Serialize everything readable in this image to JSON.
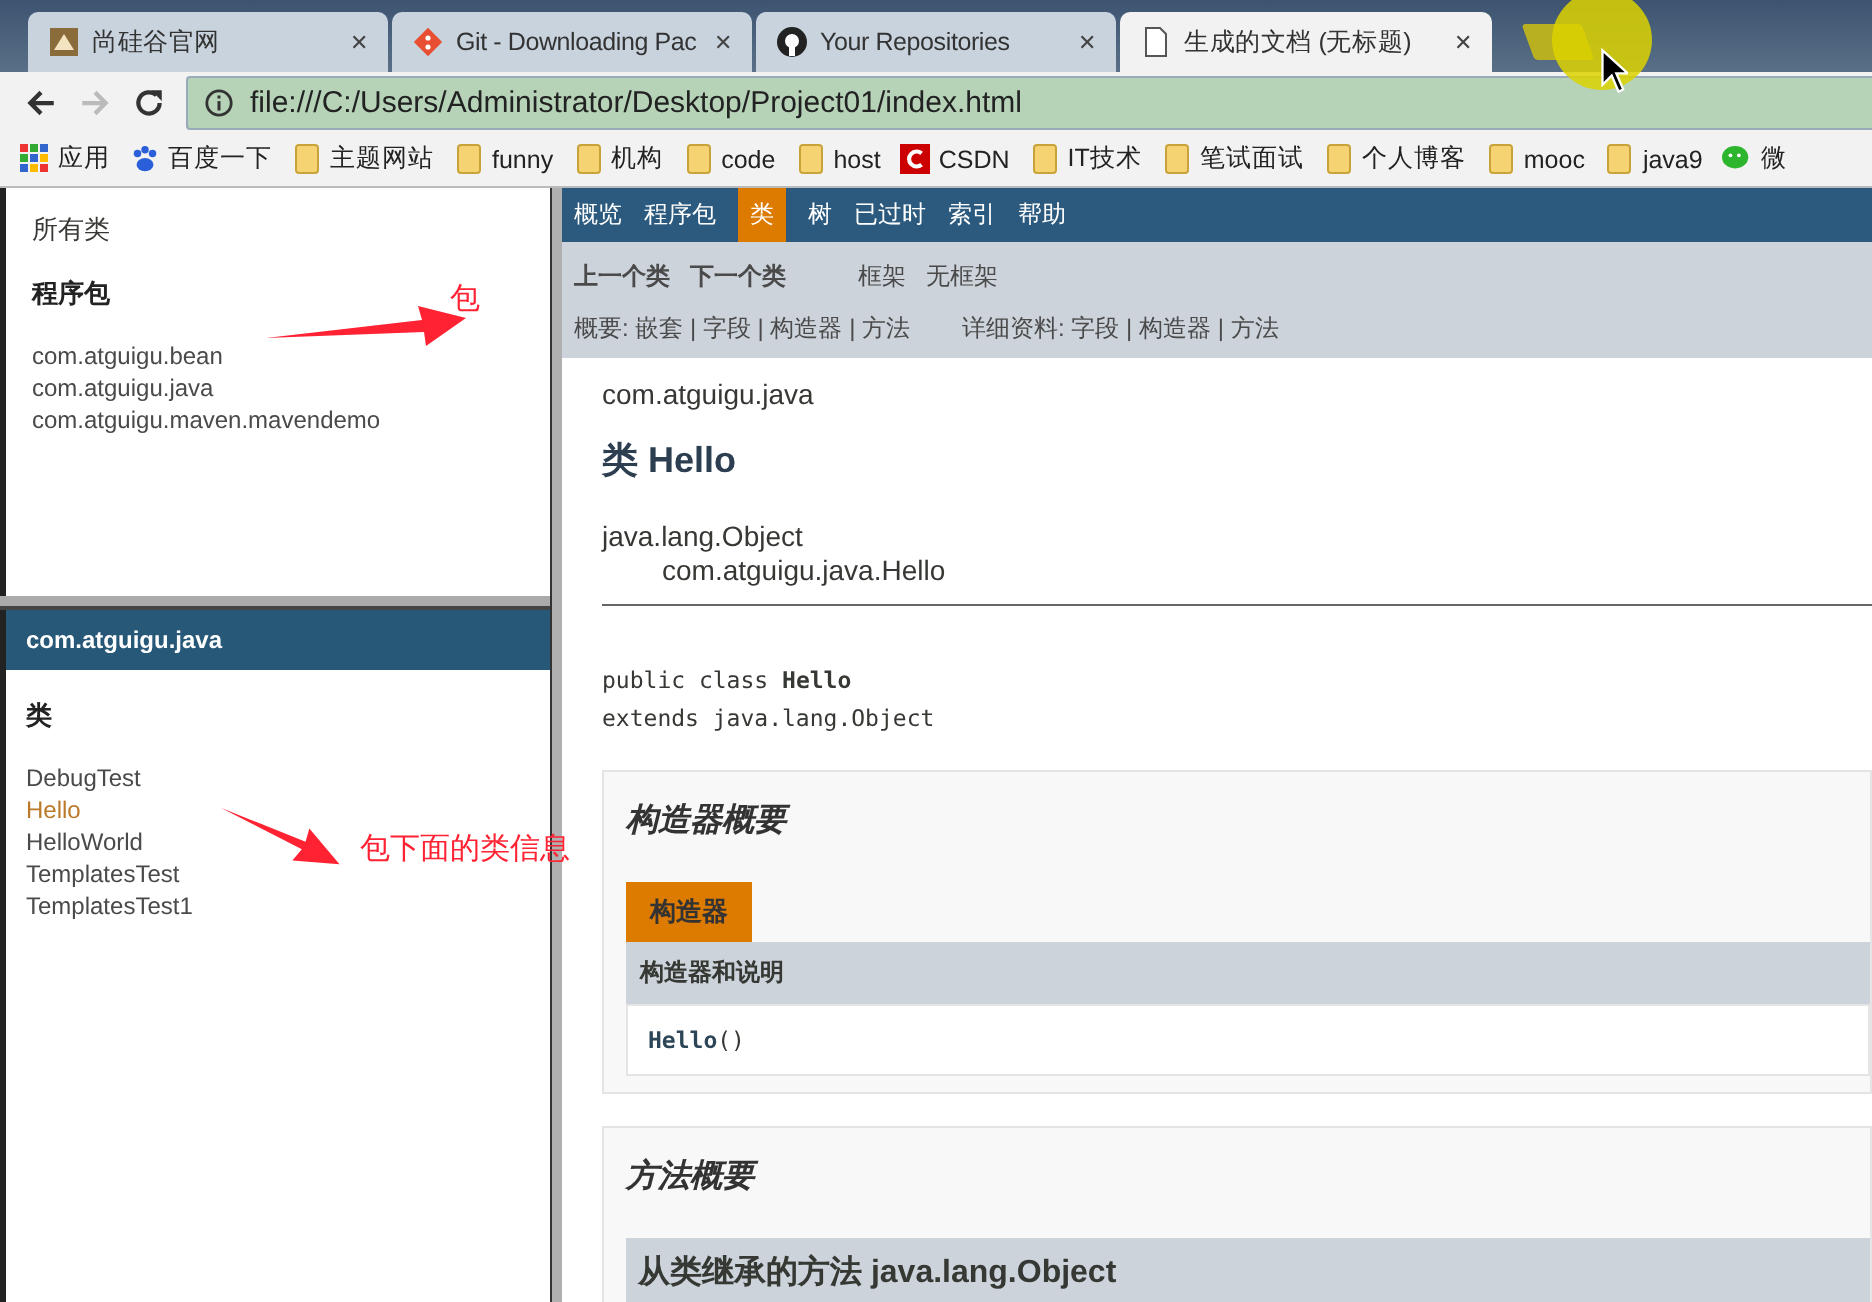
{
  "tabs": [
    {
      "title": "尚硅谷官网",
      "kind": "site",
      "close": "✕",
      "selected": false
    },
    {
      "title": "Git - Downloading Pac",
      "kind": "git",
      "close": "✕",
      "selected": false
    },
    {
      "title": "Your Repositories",
      "kind": "github",
      "close": "✕",
      "selected": false
    },
    {
      "title": "生成的文档 (无标题)",
      "kind": "page",
      "close": "✕",
      "selected": true
    }
  ],
  "address": {
    "url": "file:///C:/Users/Administrator/Desktop/Project01/index.html"
  },
  "bookmarks": [
    {
      "label": "应用",
      "kind": "apps"
    },
    {
      "label": "百度一下",
      "kind": "paw"
    },
    {
      "label": "主题网站",
      "kind": "folder"
    },
    {
      "label": "funny",
      "kind": "folder"
    },
    {
      "label": "机构",
      "kind": "folder"
    },
    {
      "label": "code",
      "kind": "folder"
    },
    {
      "label": "host",
      "kind": "folder"
    },
    {
      "label": "CSDN",
      "kind": "csdn"
    },
    {
      "label": "IT技术",
      "kind": "folder"
    },
    {
      "label": "笔试面试",
      "kind": "folder"
    },
    {
      "label": "个人博客",
      "kind": "folder"
    },
    {
      "label": "mooc",
      "kind": "folder"
    },
    {
      "label": "java9",
      "kind": "folder"
    },
    {
      "label": "微",
      "kind": "chat"
    }
  ],
  "packages_frame": {
    "all_classes": "所有类",
    "heading": "程序包",
    "packages": [
      "com.atguigu.bean",
      "com.atguigu.java",
      "com.atguigu.maven.mavendemo"
    ]
  },
  "classes_frame": {
    "title": "com.atguigu.java",
    "heading": "类",
    "classes": [
      {
        "name": "DebugTest",
        "selected": false
      },
      {
        "name": "Hello",
        "selected": true
      },
      {
        "name": "HelloWorld",
        "selected": false
      },
      {
        "name": "TemplatesTest",
        "selected": false
      },
      {
        "name": "TemplatesTest1",
        "selected": false
      }
    ]
  },
  "annotations": [
    "包",
    "包下面的类信息"
  ],
  "nav": [
    {
      "label": "概览",
      "selected": false
    },
    {
      "label": "程序包",
      "selected": false
    },
    {
      "label": "类",
      "selected": true
    },
    {
      "label": "树",
      "selected": false
    },
    {
      "label": "已过时",
      "selected": false
    },
    {
      "label": "索引",
      "selected": false
    },
    {
      "label": "帮助",
      "selected": false
    }
  ],
  "subnav": {
    "prev": "上一个类",
    "next": "下一个类",
    "frames": "框架",
    "no_frames": "无框架",
    "summary": "概要: 嵌套 | 字段 | 构造器 | 方法",
    "detail": "详细资料: 字段 | 构造器 | 方法"
  },
  "content": {
    "package": "com.atguigu.java",
    "title": "类 Hello",
    "hierarchy": [
      "java.lang.Object",
      "com.atguigu.java.Hello"
    ],
    "declaration": [
      "public class **Hello**",
      "extends java.lang.Object"
    ],
    "constructor_summary": {
      "heading": "构造器概要",
      "tab": "构造器",
      "column": "构造器和说明",
      "constructor_name": "Hello",
      "constructor_params": "()"
    },
    "method_summary": {
      "heading": "方法概要",
      "inherited": "从类继承的方法 java.lang.Object"
    }
  }
}
